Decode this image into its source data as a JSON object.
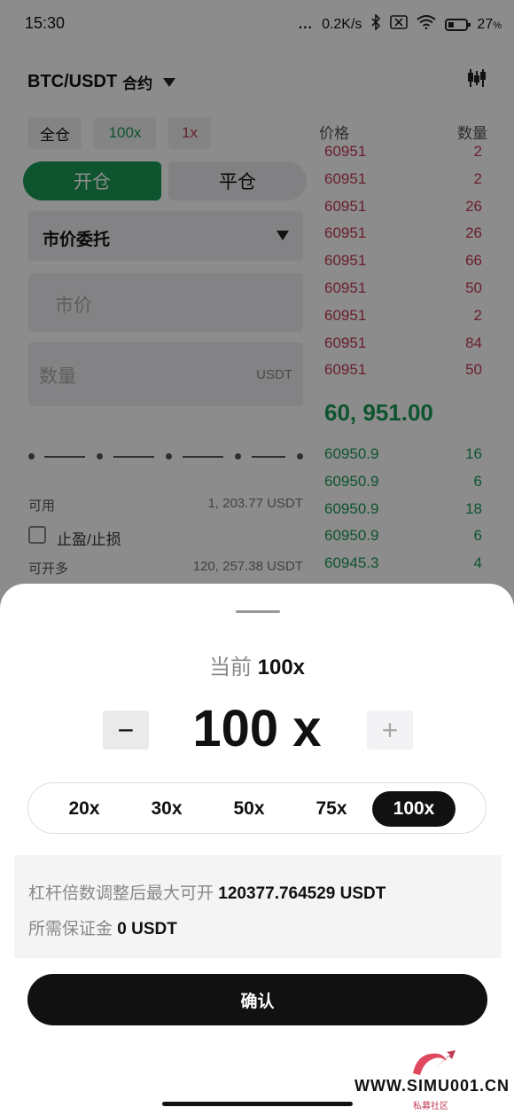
{
  "status_bar": {
    "time": "15:30",
    "dots": "...",
    "network_speed": "0.2K/s",
    "battery": "27"
  },
  "header": {
    "pair": "BTC/USDT",
    "contract_label": "合约"
  },
  "chips": {
    "margin_mode": "全仓",
    "long_leverage": "100x",
    "short_leverage": "1x"
  },
  "tabs": {
    "open": "开仓",
    "close": "平仓"
  },
  "order_type": "市价委托",
  "inputs": {
    "price_placeholder": "市价",
    "qty_placeholder": "数量",
    "qty_unit": "USDT"
  },
  "account": {
    "available_label": "可用",
    "available_value": "1, 203.77 USDT",
    "tp_sl_label": "止盈/止损",
    "can_open_label": "可开多",
    "can_open_value": "120, 257.38 USDT"
  },
  "orderbook": {
    "price_header": "价格",
    "qty_header": "数量",
    "asks": [
      {
        "price": "60951",
        "qty": "2"
      },
      {
        "price": "60951",
        "qty": "2"
      },
      {
        "price": "60951",
        "qty": "26"
      },
      {
        "price": "60951",
        "qty": "26"
      },
      {
        "price": "60951",
        "qty": "66"
      },
      {
        "price": "60951",
        "qty": "50"
      },
      {
        "price": "60951",
        "qty": "2"
      },
      {
        "price": "60951",
        "qty": "84"
      },
      {
        "price": "60951",
        "qty": "50"
      }
    ],
    "last_price": "60, 951.00",
    "bids": [
      {
        "price": "60950.9",
        "qty": "16"
      },
      {
        "price": "60950.9",
        "qty": "6"
      },
      {
        "price": "60950.9",
        "qty": "18"
      },
      {
        "price": "60950.9",
        "qty": "6"
      },
      {
        "price": "60945.3",
        "qty": "4"
      }
    ],
    "colors": {
      "ask": "#c23a55",
      "bid": "#1a9a55"
    }
  },
  "sheet": {
    "current_label": "当前",
    "current_value": "100x",
    "minus": "−",
    "plus": "+",
    "leverage_display": "100 x",
    "presets": [
      "20x",
      "30x",
      "50x",
      "75x",
      "100x"
    ],
    "selected_preset": "100x",
    "max_open_label": "杠杆倍数调整后最大可开",
    "max_open_value": "120377.764529 USDT",
    "margin_label": "所需保证金",
    "margin_value": "0 USDT",
    "confirm": "确认"
  },
  "watermark": {
    "text": "WWW.SIMU001.CN",
    "sub": "私募社区"
  }
}
